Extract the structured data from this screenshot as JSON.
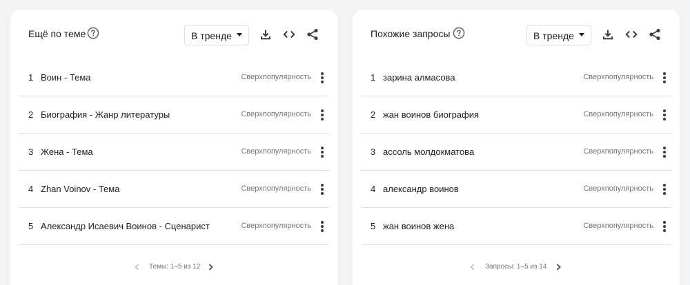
{
  "left_panel": {
    "title": "Ещё по теме",
    "help_icon": "help-circle-icon",
    "dropdown": {
      "selected": "В тренде"
    },
    "tools": [
      "download-icon",
      "embed-code-icon",
      "share-icon"
    ],
    "rows": [
      {
        "num": "1",
        "label": "Воин - Тема",
        "status": "Сверхпопулярность"
      },
      {
        "num": "2",
        "label": "Биография - Жанр литературы",
        "status": "Сверхпопулярность"
      },
      {
        "num": "3",
        "label": "Жена - Тема",
        "status": "Сверхпопулярность"
      },
      {
        "num": "4",
        "label": "Zhan Voinov - Тема",
        "status": "Сверхпопулярность"
      },
      {
        "num": "5",
        "label": "Александр Исаевич Воинов - Сценарист",
        "status": "Сверхпопулярность"
      }
    ],
    "pager": {
      "text": "Темы: 1–5 из 12"
    }
  },
  "right_panel": {
    "title": "Похожие запросы",
    "help_icon": "help-circle-icon",
    "dropdown": {
      "selected": "В тренде"
    },
    "tools": [
      "download-icon",
      "embed-code-icon",
      "share-icon"
    ],
    "rows": [
      {
        "num": "1",
        "label": "зарина алмасова",
        "status": "Сверхпопулярность"
      },
      {
        "num": "2",
        "label": "жан воинов биография",
        "status": "Сверхпопулярность"
      },
      {
        "num": "3",
        "label": "ассоль молдокматова",
        "status": "Сверхпопулярность"
      },
      {
        "num": "4",
        "label": "александр воинов",
        "status": "Сверхпопулярность"
      },
      {
        "num": "5",
        "label": "жан воинов жена",
        "status": "Сверхпопулярность"
      }
    ],
    "pager": {
      "text": "Запросы: 1–5 из 14"
    }
  },
  "colors": {
    "background": "#f1f3f4",
    "card": "#ffffff",
    "text": "#202124",
    "secondary_text": "#70757a",
    "divider": "#e0e0e0"
  }
}
